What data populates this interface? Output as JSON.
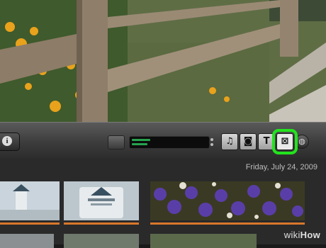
{
  "toolbar": {
    "info_glyph": "i",
    "tools": [
      {
        "name": "music-tool-button",
        "glyph": "♫",
        "icon": "music-note-icon",
        "selected": false
      },
      {
        "name": "photo-tool-button",
        "glyph": "◙",
        "icon": "camera-icon",
        "selected": false
      },
      {
        "name": "title-tool-button",
        "glyph": "T",
        "icon": "text-icon",
        "selected": false
      },
      {
        "name": "transition-tool-button",
        "glyph": "⊠",
        "icon": "transition-icon",
        "selected": true
      },
      {
        "name": "map-tool-button",
        "glyph": "◍",
        "icon": "globe-icon",
        "selected": false
      }
    ],
    "highlight_color": "#22e41d"
  },
  "event_browser": {
    "date_label": "Friday, July 24, 2009",
    "clip_accent": "#d8772a"
  },
  "watermark": {
    "text_wiki": "wiki",
    "text_how": "How"
  }
}
